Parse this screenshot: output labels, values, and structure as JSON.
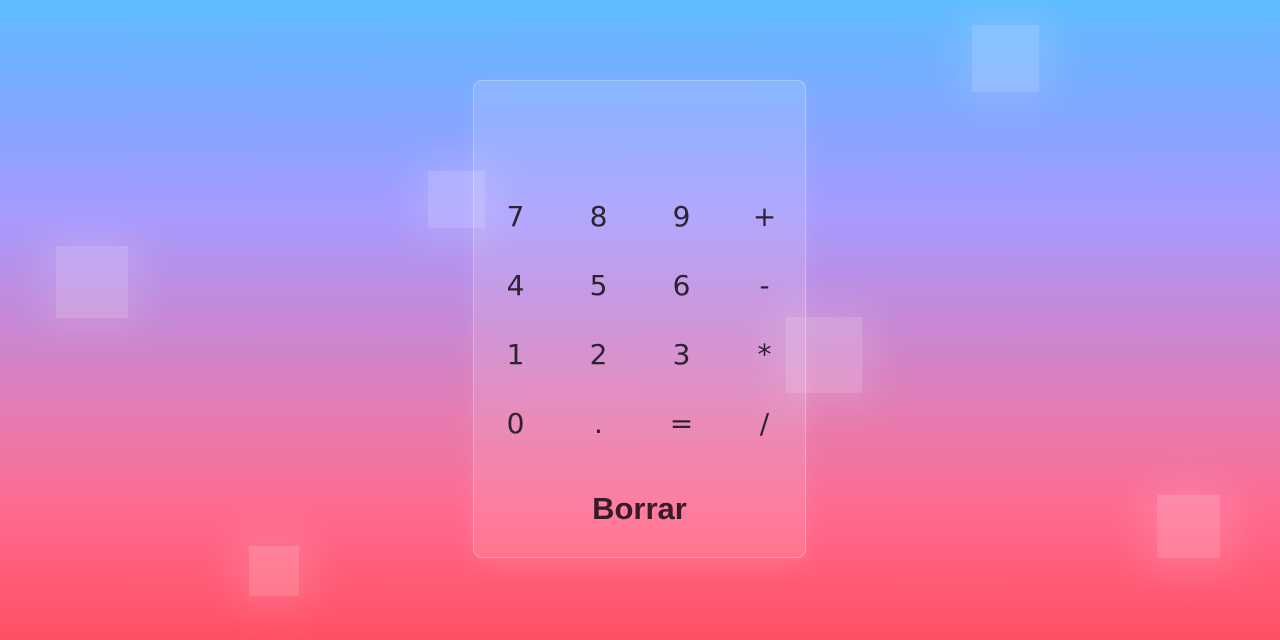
{
  "calculator": {
    "display_value": "",
    "keys": [
      "7",
      "8",
      "9",
      "+",
      "4",
      "5",
      "6",
      "-",
      "1",
      "2",
      "3",
      "*",
      "0",
      ".",
      "=",
      "/"
    ],
    "clear_label": "Borrar"
  }
}
